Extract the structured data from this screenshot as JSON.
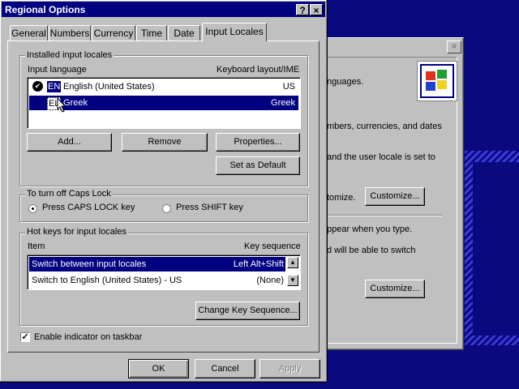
{
  "window": {
    "title": "Regional Options",
    "help_label": "?",
    "close_label": "×"
  },
  "tabs": [
    {
      "label": "General"
    },
    {
      "label": "Numbers"
    },
    {
      "label": "Currency"
    },
    {
      "label": "Time"
    },
    {
      "label": "Date"
    },
    {
      "label": "Input Locales"
    }
  ],
  "installed": {
    "group_label": "Installed input locales",
    "col_language": "Input language",
    "col_layout": "Keyboard layout/IME",
    "rows": [
      {
        "code": "EN",
        "language": "English (United States)",
        "layout": "US"
      },
      {
        "code": "EL",
        "language": "Greek",
        "layout": "Greek"
      }
    ],
    "buttons": {
      "add": "Add...",
      "remove": "Remove",
      "properties": "Properties...",
      "set_default": "Set as Default"
    }
  },
  "capslock": {
    "group_label": "To turn off Caps Lock",
    "option1": "Press CAPS LOCK key",
    "option2": "Press SHIFT key"
  },
  "hotkeys": {
    "group_label": "Hot keys for input locales",
    "col_item": "Item",
    "col_seq": "Key sequence",
    "rows": [
      {
        "item": "Switch between input locales",
        "seq": "Left Alt+Shift"
      },
      {
        "item": "Switch to English (United States) - US",
        "seq": "(None)"
      }
    ],
    "change_button": "Change Key Sequence..."
  },
  "indicator_label": "Enable indicator on taskbar",
  "footer": {
    "ok": "OK",
    "cancel": "Cancel",
    "apply": "Apply"
  },
  "back_dialog": {
    "text1": "nguages.",
    "text2": "mbers, currencies, and dates",
    "text3": "and the user locale is set to",
    "text4": "tomize.",
    "customize1": "Customize...",
    "text5": "ppear when you type.",
    "text6": "d will be able to switch",
    "customize2": "Customize..."
  },
  "colors": {
    "desktop": "#0a0a80",
    "titlebar": "#000080",
    "face": "#c0c0c0",
    "selection": "#000080"
  }
}
